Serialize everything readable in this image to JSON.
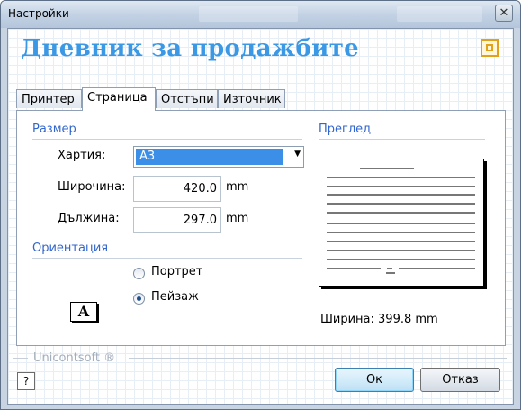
{
  "window": {
    "title": "Настройки",
    "close_glyph": "✕"
  },
  "header": {
    "title": "Дневник за продажбите",
    "icon": "app-settings-icon",
    "accent": "#3b98e4"
  },
  "tabs": [
    {
      "label": "Принтер",
      "active": false
    },
    {
      "label": "Страница",
      "active": true
    },
    {
      "label": "Отстъпи",
      "active": false
    },
    {
      "label": "Източник",
      "active": false
    }
  ],
  "size_group": {
    "title": "Размер",
    "paper_label": "Хартия:",
    "paper_value": "A3",
    "width_label": "Широчина:",
    "width_value": "420.0",
    "length_label": "Дължина:",
    "length_value": "297.0",
    "unit": "mm"
  },
  "orientation_group": {
    "title": "Ориентация",
    "icon_letter": "A",
    "portrait_label": "Портрет",
    "landscape_label": "Пейзаж",
    "selected": "landscape"
  },
  "preview_group": {
    "title": "Преглед",
    "width_text": "Ширина: 399.8 mm"
  },
  "footer": {
    "brand": "Unicontsoft ®",
    "help_glyph": "?",
    "ok_label": "Ок",
    "cancel_label": "Отказ"
  }
}
